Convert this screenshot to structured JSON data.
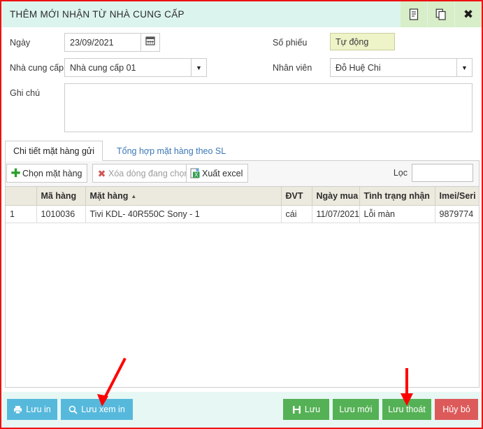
{
  "window": {
    "title": "THÊM MỚI NHẬN TỪ NHÀ CUNG CẤP",
    "buttons": [
      {
        "name": "document-icon",
        "label": ""
      },
      {
        "name": "copy-icon",
        "label": ""
      },
      {
        "name": "close-icon",
        "label": "✖"
      }
    ]
  },
  "form": {
    "date_label": "Ngày",
    "date_value": "23/09/2021",
    "voucher_label": "Số phiếu",
    "voucher_value": "Tự động",
    "supplier_label": "Nhà cung cấp",
    "supplier_value": "Nhà cung cấp 01",
    "employee_label": "Nhân viên",
    "employee_value": "Đỗ Huệ Chi",
    "note_label": "Ghi chú",
    "note_value": "",
    "note_placeholder": ""
  },
  "tabs": [
    {
      "label": "Chi tiết mặt hàng gửi",
      "active": true
    },
    {
      "label": "Tổng hợp mặt hàng theo SL",
      "active": false
    }
  ],
  "grid_toolbar": {
    "select_item_label": "Chọn mặt hàng",
    "delete_row_label": "Xóa dòng đang chọn",
    "export_excel_label": "Xuất excel",
    "filter_label": "Lọc",
    "filter_value": "",
    "filter_placeholder": ""
  },
  "grid": {
    "columns": [
      {
        "key": "stt",
        "label": ""
      },
      {
        "key": "ma_hang",
        "label": "Mã hàng"
      },
      {
        "key": "mat_hang",
        "label": "Mặt hàng",
        "sort": "▲"
      },
      {
        "key": "dvt",
        "label": "ĐVT"
      },
      {
        "key": "ngay_mua",
        "label": "Ngày mua"
      },
      {
        "key": "tinh_trang",
        "label": "Tình trạng nhận"
      },
      {
        "key": "imei",
        "label": "Imei/Seri"
      }
    ],
    "rows": [
      {
        "stt": "1",
        "ma_hang": "1010036",
        "mat_hang": "Tivi KDL- 40R550C Sony - 1",
        "dvt": "cái",
        "ngay_mua": "11/07/2021",
        "tinh_trang": "Lỗi màn",
        "imei": "9879774"
      }
    ]
  },
  "footer": {
    "save_print_label": "Lưu in",
    "save_preview_label": "Lưu xem in",
    "save_label": "Lưu",
    "save_new_label": "Lưu mới",
    "save_exit_label": "Lưu thoát",
    "cancel_label": "Hủy bỏ"
  },
  "colors": {
    "header_bg": "#dcf4ee",
    "header_btn_bg": "#d7eec8",
    "accent_blue": "#56b9dc",
    "accent_green": "#55b155",
    "accent_red": "#dd5a5a",
    "auto_field_bg": "#eef3c8",
    "grid_header_bg": "#eceade",
    "annotation_arrow": "#ff0000",
    "window_border": "#ee1111"
  }
}
